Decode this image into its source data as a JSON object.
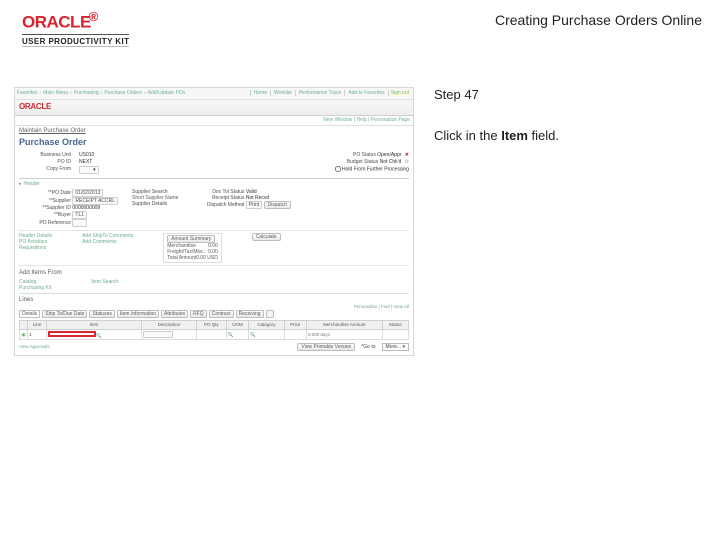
{
  "header": {
    "brand": "ORACLE",
    "kit": "USER PRODUCTIVITY KIT",
    "topic": "Creating Purchase Orders Online"
  },
  "instruction": {
    "step_label": "Step 47",
    "pre": "Click in the ",
    "bold": "Item",
    "post": " field."
  },
  "shot": {
    "breadcrumb": [
      "Favorites",
      "Main Menu",
      "Purchasing",
      "Purchase Orders",
      "Add/Update POs"
    ],
    "topnav": [
      "Home",
      "Worklist",
      "Performance Trace",
      "Add to Favorites",
      "Sign out"
    ],
    "subnav_left": "New Window | Help | Personalize Page",
    "maintain_label": "Maintain Purchase Order",
    "po_title": "Purchase Order",
    "fields": {
      "bu_label": "Business Unit",
      "bu_value": "US010",
      "poid_label": "PO ID",
      "poid_value": "NEXT",
      "copy_label": "Copy From",
      "postatus_label": "PO Status",
      "postatus_value": "Open/Appr",
      "budget_label": "Budget Status",
      "budget_value": "Not Chk'd",
      "hold_label": "Hold From Further Processing"
    },
    "header_section": "Header",
    "header_fields": {
      "podate_label": "*PO Date",
      "podate_value": "01/02/2013",
      "supplier_label": "*Supplier",
      "supplier_value": "RECEIPT ACCRL",
      "supplierid_label": "*Supplier ID",
      "supplierid_value": "0000000009",
      "buyer_label": "*Buyer",
      "buyer_value": "TL1",
      "poref_label": "PO Reference",
      "supplier_search": "Supplier Search",
      "supplier_details": "Supplier Details",
      "doc_label": "Doc Tol Status",
      "doc_value": "Valid",
      "rcpt_label": "Receipt Status",
      "rcpt_value": "Not Recvd",
      "disp_label": "Dispatch Method",
      "disp_value": "Print",
      "dispatch_btn": "Dispatch"
    },
    "hd_block": {
      "col1": [
        "Header Details",
        "PO Activities",
        "Requisitions"
      ],
      "col2": [
        "Add ShipTo Comments",
        "Add Comments"
      ],
      "amt_summary_btn": "Amount Summary",
      "merch_label": "Merchandise",
      "merch_value": "0.00",
      "ft_label": "Freight/Tax/Misc.",
      "ft_value": "0.00",
      "total_label": "Total Amount",
      "total_value": "0.00   USD",
      "calculate_btn": "Calculate"
    },
    "additems": {
      "title": "Add Items From",
      "a": "Catalog",
      "b": "Item Search",
      "c": "Purchasing Kit"
    },
    "lines": {
      "title": "Lines",
      "tabs": [
        "Details",
        "Ship To/Due Date",
        "Statuses",
        "Item Information",
        "Attributes",
        "RFQ",
        "Contract",
        "Receiving"
      ],
      "icons_alt": "Personalize | Find | View All",
      "cols": [
        "",
        "Line",
        "Item",
        "Description",
        "PO Qty",
        "UOM",
        "Category",
        "Price",
        "Merchandise Amount",
        "Status"
      ],
      "row_line": "1",
      "row_amount": "0.000 days",
      "footer_btn": "View Printable Version",
      "footer_sel_label": "*Go to",
      "footer_sel_value": "More..."
    }
  }
}
